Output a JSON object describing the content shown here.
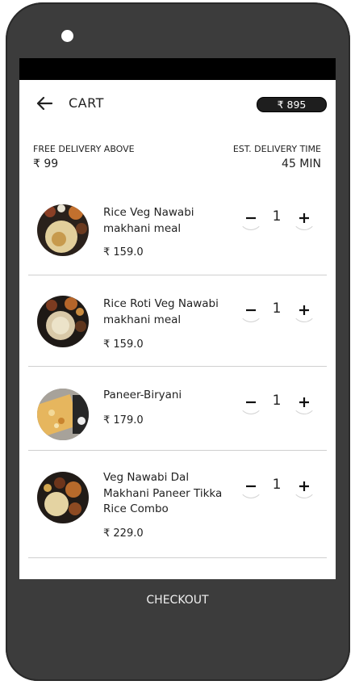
{
  "header": {
    "title": "CART",
    "total": "₹ 895"
  },
  "info": {
    "free_delivery_label": "FREE DELIVERY ABOVE",
    "free_delivery_value": "₹ 99",
    "delivery_time_label": "EST. DELIVERY TIME",
    "delivery_time_value": "45 MIN"
  },
  "items": [
    {
      "name": "Rice Veg Nawabi makhani meal",
      "price": "₹ 159.0",
      "qty": "1"
    },
    {
      "name": "Rice Roti Veg Nawabi makhani meal",
      "price": "₹ 159.0",
      "qty": "1"
    },
    {
      "name": "Paneer-Biryani",
      "price": "₹ 179.0",
      "qty": "1"
    },
    {
      "name": "Veg Nawabi Dal Makhani Paneer Tikka Rice Combo",
      "price": "₹ 229.0",
      "qty": "1"
    }
  ],
  "checkout_label": "CHECKOUT",
  "colors": {
    "phone_body": "#3c3c3c",
    "badge": "#1e1e1e",
    "divider": "#cfcfcf"
  },
  "icons": {
    "back": "arrow-left-icon",
    "minus": "minus-icon",
    "plus": "plus-icon"
  }
}
